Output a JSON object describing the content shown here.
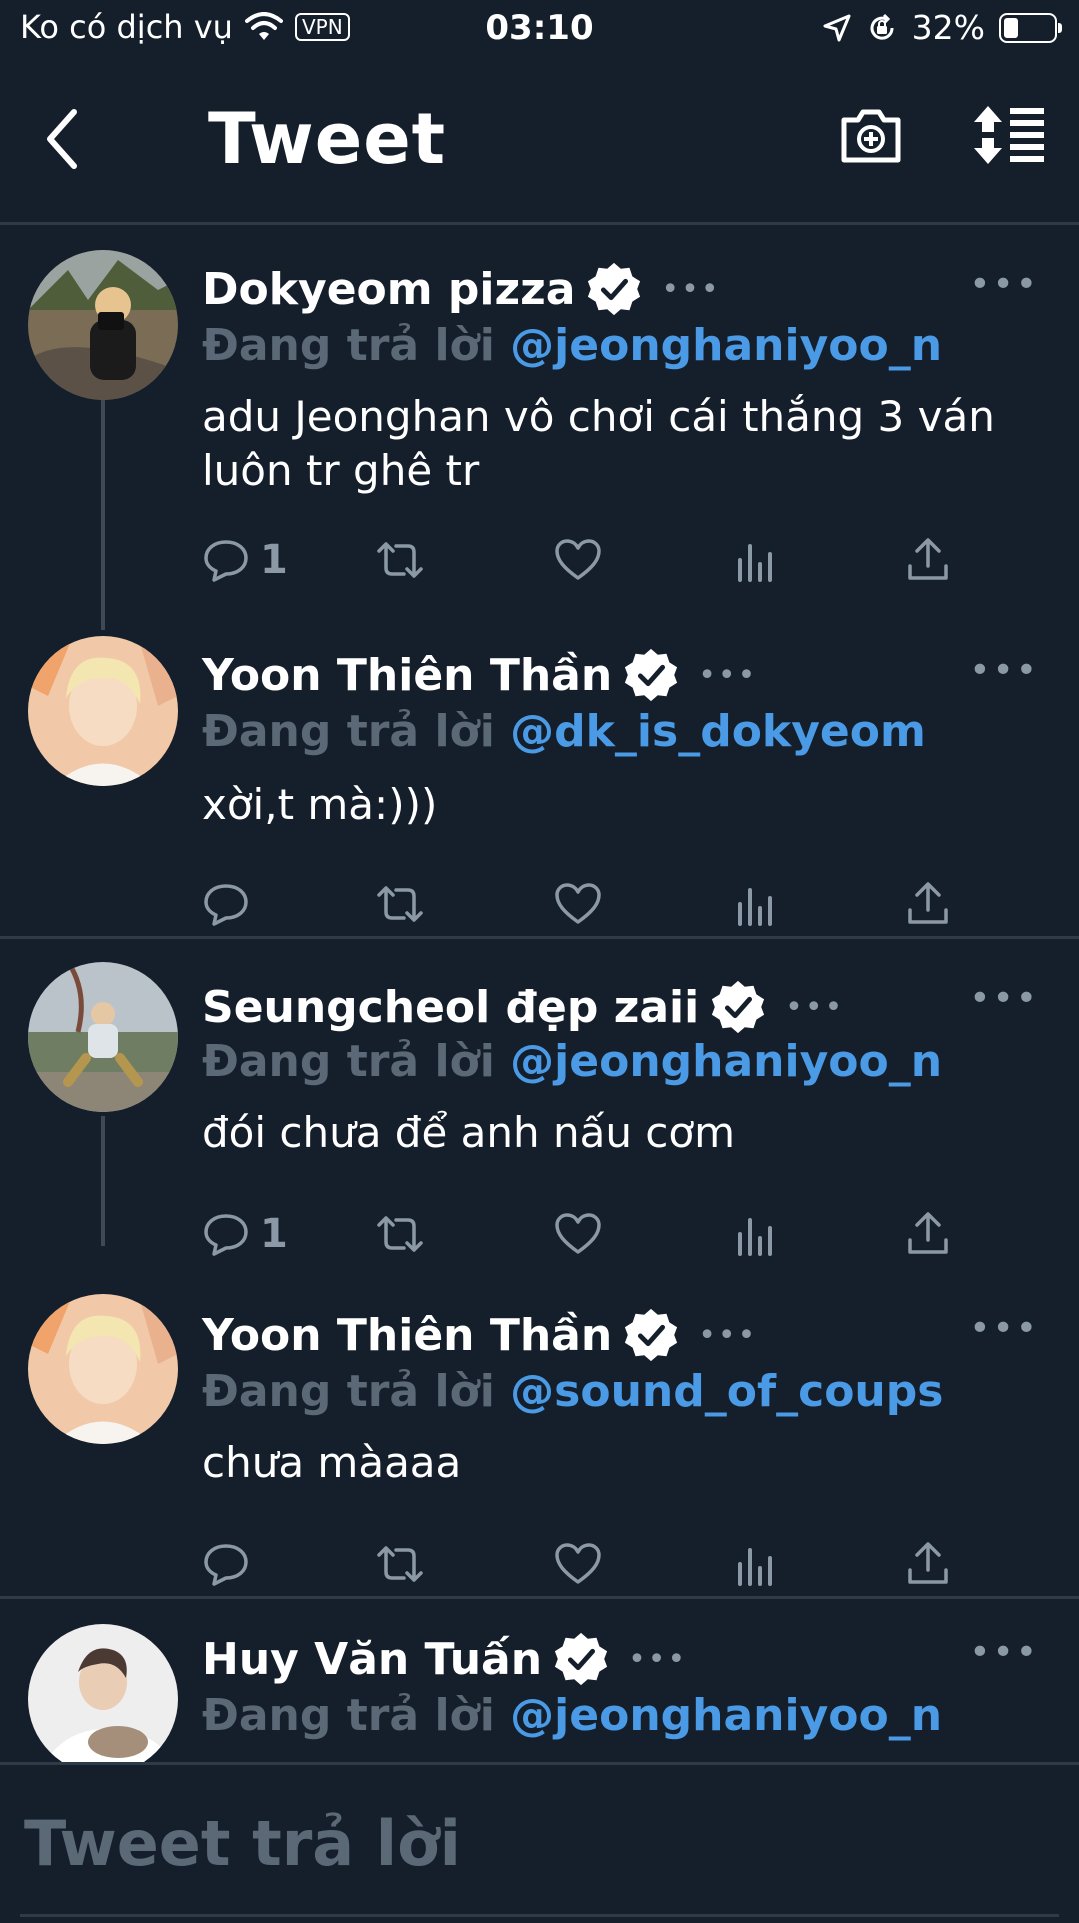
{
  "status_bar": {
    "carrier": "Ko có dịch vụ",
    "vpn": "VPN",
    "time": "03:10",
    "battery": "32%",
    "battery_level": 0.32
  },
  "header": {
    "title": "Tweet",
    "back_icon": "chevron-left-icon",
    "camera_icon": "camera-add-icon",
    "sort_icon": "sort-icon"
  },
  "colors": {
    "background": "#151f2b",
    "link": "#4a9ae6",
    "muted": "#5b6876",
    "icon": "#8b98a5"
  },
  "tweets": [
    {
      "name": "Dokyeom pizza",
      "reply_label": "Đang trả lời",
      "handle": "@jeonghaniyoo_n",
      "text": "adu Jeonghan vô chơi cái thắng 3 ván luôn tr ghê tr",
      "reply_count": "1"
    },
    {
      "name": "Yoon Thiên Thần",
      "reply_label": "Đang trả lời",
      "handle": "@dk_is_dokyeom",
      "text": "xời,t mà:)))",
      "reply_count": ""
    },
    {
      "name": "Seungcheol đẹp zaii",
      "reply_label": "Đang trả lời",
      "handle": "@jeonghaniyoo_n",
      "text": "đói chưa để anh nấu cơm",
      "reply_count": "1"
    },
    {
      "name": "Yoon Thiên Thần",
      "reply_label": "Đang trả lời",
      "handle": "@sound_of_coups",
      "text": "chưa màaaa",
      "reply_count": ""
    },
    {
      "name": "Huy Văn Tuấn",
      "reply_label": "Đang trả lời",
      "handle": "@jeonghaniyoo_n",
      "text": "",
      "reply_count": ""
    }
  ],
  "reply_bar": {
    "placeholder": "Tweet trả lời"
  }
}
